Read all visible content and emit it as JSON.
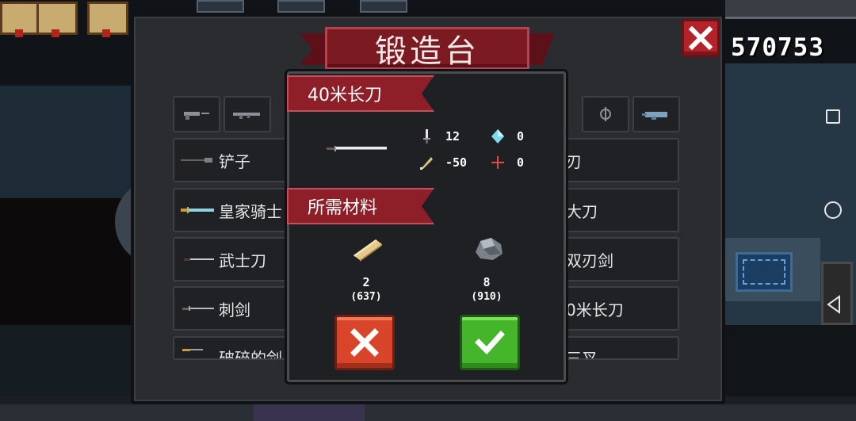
{
  "hud": {
    "coins": "570753"
  },
  "forge": {
    "title": "锻造台",
    "left_list": [
      {
        "label": "铲子",
        "icon": "shovel-icon"
      },
      {
        "label": "皇家骑士",
        "icon": "royal-knight-sword-icon"
      },
      {
        "label": "武士刀",
        "icon": "katana-icon"
      },
      {
        "label": "刺剑",
        "icon": "rapier-icon"
      },
      {
        "label": "破碎的剑",
        "icon": "broken-sword-icon"
      }
    ],
    "right_list": [
      {
        "label": "刃",
        "icon": "blade-icon"
      },
      {
        "label": "大刀",
        "icon": "big-blade-icon"
      },
      {
        "label": "双刃剑",
        "icon": "double-edged-sword-icon"
      },
      {
        "label": "0米长刀",
        "icon": "long-blade-icon"
      },
      {
        "label": "三叉",
        "icon": "trident-icon"
      }
    ]
  },
  "detail": {
    "weapon_name": "40米长刀",
    "stats": {
      "damage": "12",
      "energy": "0",
      "crit": "-50",
      "accuracy": "0"
    },
    "materials_title": "所需材料",
    "materials": [
      {
        "icon": "wood-plank-icon",
        "need": "2",
        "have": "(637)"
      },
      {
        "icon": "iron-ore-icon",
        "need": "8",
        "have": "(910)"
      }
    ]
  }
}
